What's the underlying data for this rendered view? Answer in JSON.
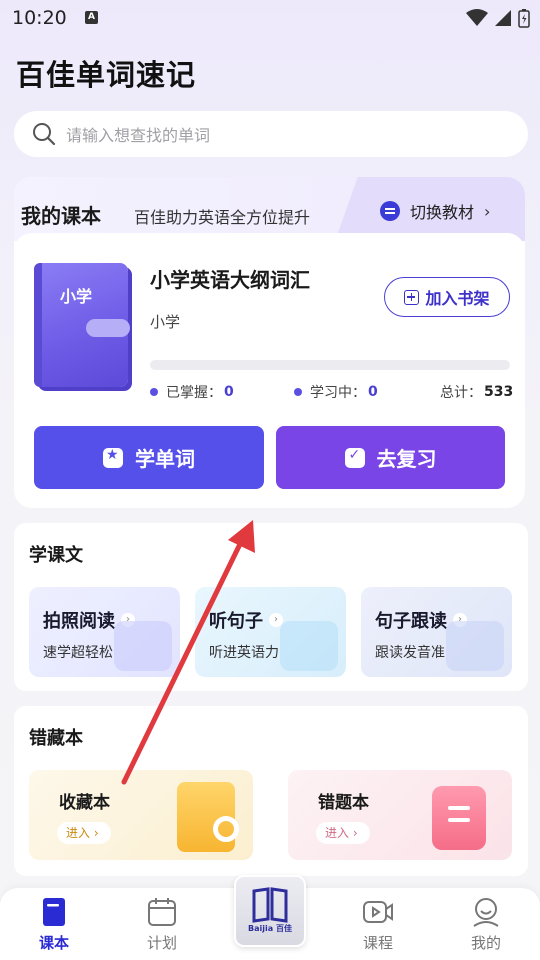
{
  "status_bar": {
    "time": "10:20",
    "notification_badge": "A"
  },
  "app": {
    "title": "百佳单词速记"
  },
  "search": {
    "placeholder": "请输入想查找的单词"
  },
  "my_books": {
    "title": "我的课本",
    "subtitle": "百佳助力英语全方位提升",
    "switch_label": "切换教材",
    "book": {
      "cover_text": "小学",
      "name": "小学英语大纲词汇",
      "grade": "小学",
      "add_shelf_label": "加入书架",
      "progress_fraction": 0,
      "mastered_label": "已掌握：",
      "mastered_value": "0",
      "learning_label": "学习中：",
      "learning_value": "0",
      "total_label": "总计：",
      "total_value": "533"
    },
    "learn_words_label": "学单词",
    "review_label": "去复习"
  },
  "learn_text": {
    "title": "学课文",
    "tiles": [
      {
        "name": "拍照阅读",
        "desc": "速学超轻松"
      },
      {
        "name": "听句子",
        "desc": "听进英语力"
      },
      {
        "name": "句子跟读",
        "desc": "跟读发音准"
      }
    ]
  },
  "favorites": {
    "title": "错藏本",
    "cards": [
      {
        "name": "收藏本",
        "enter": "进入 ›"
      },
      {
        "name": "错题本",
        "enter": "进入 ›"
      }
    ]
  },
  "tabbar": {
    "items": [
      {
        "label": "课本",
        "icon": "book-icon"
      },
      {
        "label": "计划",
        "icon": "calendar-icon"
      },
      {
        "label": "课程",
        "icon": "video-icon"
      },
      {
        "label": "我的",
        "icon": "profile-icon"
      }
    ],
    "center_logo_text": "Baijia 百佳"
  },
  "colors": {
    "accent": "#5650ea",
    "review": "#7a45e6",
    "annotation_arrow": "#e0393e"
  }
}
